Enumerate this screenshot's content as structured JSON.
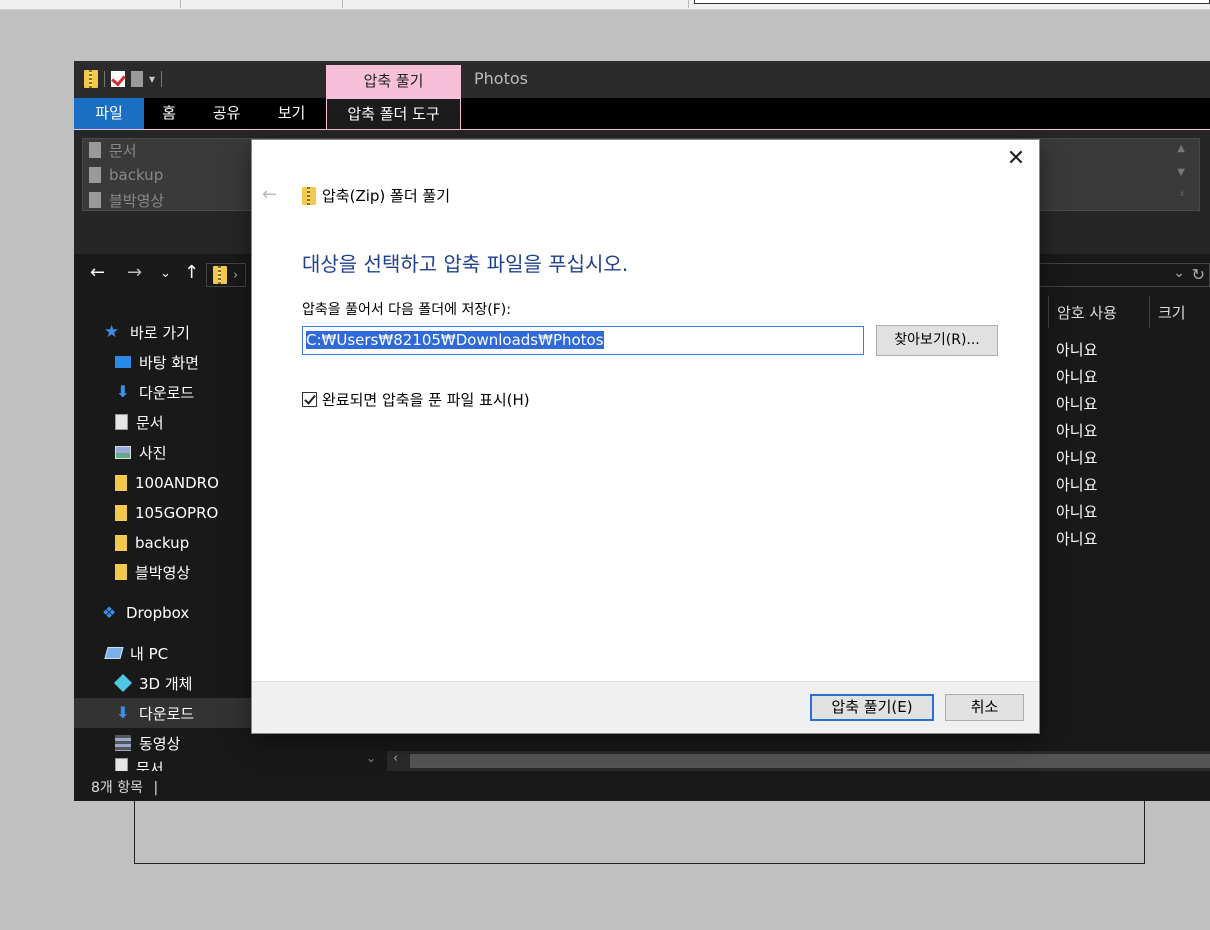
{
  "explorer": {
    "title": "Photos",
    "context_tab": "압축 풀기",
    "ribbon_tabs": {
      "file": "파일",
      "home": "홈",
      "share": "공유",
      "view": "보기",
      "tools": "압축 폴더 도구"
    },
    "gallery": [
      "문서",
      "backup",
      "블박영상"
    ],
    "sidebar": {
      "quick_access": "바로 가기",
      "items": [
        "바탕 화면",
        "다운로드",
        "문서",
        "사진",
        "100ANDRO",
        "105GOPRO",
        "backup",
        "블박영상"
      ],
      "dropbox": "Dropbox",
      "this_pc": "내 PC",
      "pc_items": [
        "3D 개체",
        "다운로드",
        "동영상",
        "문서"
      ]
    },
    "columns": {
      "password": "암호 사용",
      "size": "크기"
    },
    "password_values": [
      "아니요",
      "아니요",
      "아니요",
      "아니요",
      "아니요",
      "아니요",
      "아니요",
      "아니요"
    ],
    "status": "8개 항목"
  },
  "dialog": {
    "title": "압축(Zip) 폴더 풀기",
    "heading": "대상을 선택하고 압축 파일을 푸십시오.",
    "path_label": "압축을 풀어서 다음 폴더에 저장(F):",
    "path_value": "C:₩Users₩82105₩Downloads₩Photos",
    "browse_label": "찾아보기(R)...",
    "checkbox_label": "완료되면 압축을 푼 파일 표시(H)",
    "checkbox_checked": true,
    "extract_label": "압축 풀기(E)",
    "cancel_label": "취소"
  },
  "colors": {
    "accent": "#1a6fc4",
    "context_tab": "#f8c0d8",
    "heading": "#1f3f8f"
  }
}
